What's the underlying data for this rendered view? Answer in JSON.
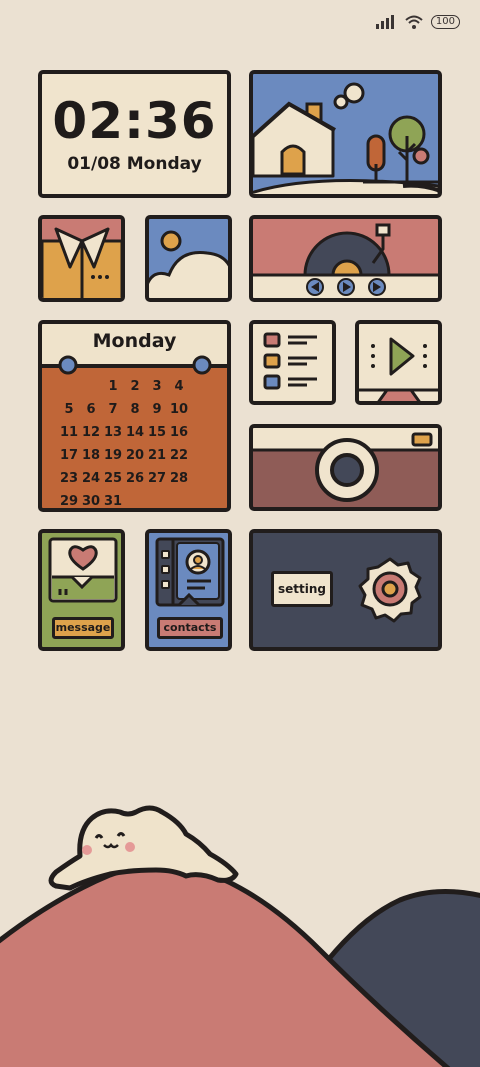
{
  "status_bar": {
    "battery": "100"
  },
  "clock": {
    "time": "02:36",
    "date": "01/08 Monday"
  },
  "calendar": {
    "month_label": "Monday",
    "cells": [
      "",
      "",
      "1",
      "2",
      "3",
      "4",
      "5",
      "6",
      "7",
      "8",
      "9",
      "10",
      "11",
      "12",
      "13",
      "14",
      "15",
      "16",
      "17",
      "18",
      "19",
      "20",
      "21",
      "22",
      "23",
      "24",
      "25",
      "26",
      "27",
      "28",
      "29",
      "30",
      "31",
      "",
      "",
      ""
    ]
  },
  "apps": {
    "message_label": "message",
    "contacts_label": "contacts",
    "setting_label": "setting"
  },
  "colors": {
    "background": "#ebe1d2",
    "outline": "#211d1c",
    "cream": "#f0e4cd",
    "blue": "#6b8abf",
    "orange": "#dea24b",
    "rust": "#c06638",
    "pink": "#c97b74",
    "green": "#8fa456",
    "navy": "#434858",
    "maroon": "#8f5c57"
  },
  "icons": [
    "wifi-icon",
    "signal-icon",
    "music-player-icon",
    "gallery-icon",
    "weather-icon",
    "checklist-icon",
    "video-icon",
    "camera-icon",
    "heart-icon",
    "gear-icon",
    "contact-person-icon"
  ]
}
